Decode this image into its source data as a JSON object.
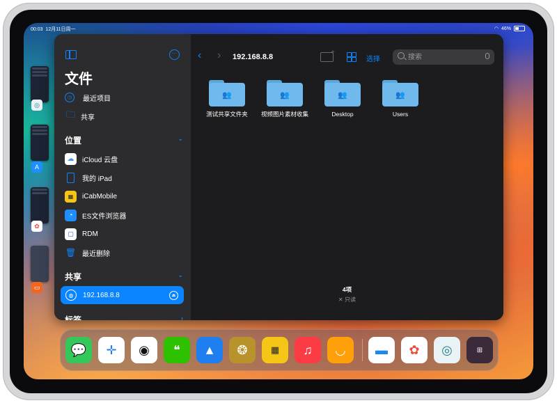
{
  "status": {
    "time": "00:03",
    "date": "12月11日周一",
    "battery": "46%"
  },
  "window": {
    "title": "文件",
    "sidebar": {
      "recents": "最近项目",
      "shared": "共享",
      "locations_heading": "位置",
      "locations": [
        "iCloud 云盘",
        "我的 iPad",
        "iCabMobile",
        "ES文件浏览器",
        "RDM",
        "最近删除"
      ],
      "shared_heading": "共享",
      "server": "192.168.8.8",
      "tags_heading": "标签"
    },
    "main": {
      "location": "192.168.8.8",
      "select_label": "选择",
      "search_placeholder": "搜索",
      "folders": [
        "测试共享文件夹",
        "视频图片素材收集",
        "Desktop",
        "Users"
      ],
      "item_count": "4项",
      "readonly": "只读"
    }
  },
  "dock": {
    "apps": [
      "messages-app",
      "safari-app",
      "qq-app",
      "wechat-app",
      "keynote-app",
      "aperture-app",
      "taxi-app",
      "music-app",
      "smile-app",
      "files-app",
      "photos-app",
      "screen-app",
      "app-library"
    ]
  }
}
